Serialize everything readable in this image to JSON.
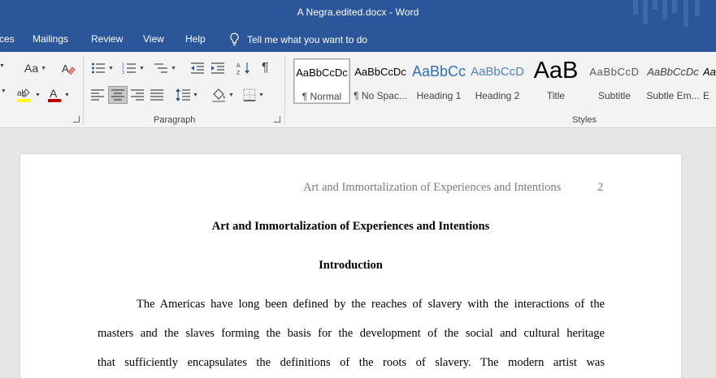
{
  "window": {
    "title": "A Negra.edited.docx  -  Word"
  },
  "tabs": [
    {
      "label": "ces"
    },
    {
      "label": "Mailings"
    },
    {
      "label": "Review"
    },
    {
      "label": "View"
    },
    {
      "label": "Help"
    }
  ],
  "tellme": {
    "label": "Tell me what you want to do"
  },
  "ribbon": {
    "font": {
      "aa_label": "Aa"
    },
    "paragraph": {
      "group_label": "Paragraph"
    },
    "styles": {
      "group_label": "Styles",
      "items": [
        {
          "preview": "AaBbCcDc",
          "label": "¶ Normal"
        },
        {
          "preview": "AaBbCcDc",
          "label": "¶ No Spac..."
        },
        {
          "preview": "AaBbCc",
          "label": "Heading 1"
        },
        {
          "preview": "AaBbCcD",
          "label": "Heading 2"
        },
        {
          "preview": "AaB",
          "label": "Title"
        },
        {
          "preview": "AaBbCcD",
          "label": "Subtitle"
        },
        {
          "preview": "AaBbCcDc",
          "label": "Subtle Em..."
        },
        {
          "preview": "Aa",
          "label": "E"
        }
      ]
    }
  },
  "document": {
    "running_head": "Art and Immortalization of Experiences and Intentions",
    "page_number": "2",
    "title": "Art and Immortalization of Experiences and Intentions",
    "heading": "Introduction",
    "paragraph_lines": [
      "The Americas have long been defined by the reaches of slavery with the interactions of the",
      "masters and the slaves forming the basis for the development of the social and cultural heritage",
      "that sufficiently encapsulates the definitions of the roots of slavery. The modern artist was"
    ]
  },
  "colors": {
    "title_bar": "#2b579a",
    "ribbon_bg": "#f3f3f3",
    "canvas_bg": "#e6e6e6",
    "heading1": "#2f6fb4",
    "heading2": "#4f85c4",
    "highlight_yellow": "#ffff00",
    "font_color_red": "#c00000"
  }
}
